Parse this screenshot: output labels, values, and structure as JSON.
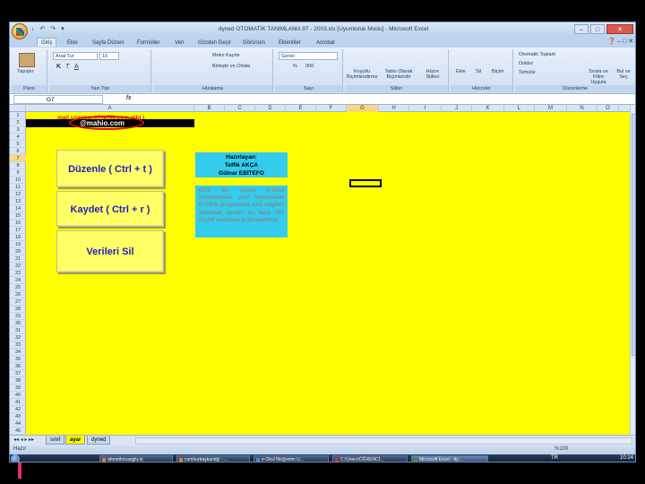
{
  "window": {
    "title": "dyned OTOMATİK TANIMLAMA  97 - 2003.xls  [Uyumluluk Modu]  -  Microsoft Excel",
    "qat": "↓ ↶ ↷ ▾",
    "min": "–",
    "max": "□",
    "close": "✕"
  },
  "ribbon": {
    "tabs": [
      "Giriş",
      "Ekle",
      "Sayfa Düzeni",
      "Formüller",
      "Veri",
      "Gözden Geçir",
      "Görünüm",
      "Eklentiler",
      "Acrobat"
    ],
    "right_icons": "❓ – □ ✕",
    "groups": {
      "clipboard": {
        "label": "Pano",
        "paste": "Yapıştır"
      },
      "font": {
        "label": "Yazı Tipi",
        "font_name": "Arial Tur",
        "font_size": "10",
        "bold": "K",
        "italic": "T",
        "underline": "A"
      },
      "alignment": {
        "label": "Hizalama",
        "wrap": "Metni Kaydır",
        "merge": "Birleştir ve Ortala"
      },
      "number": {
        "label": "Sayı",
        "format": "Genel",
        "percent": "%",
        "comma": "000"
      },
      "styles": {
        "label": "Stiller",
        "conditional": "Koşullu Biçimlendirme",
        "table": "Tablo Olarak Biçimlendir",
        "cell": "Hücre Stilleri"
      },
      "cells": {
        "label": "Hücreler",
        "insert": "Ekle",
        "delete": "Sil",
        "format": "Biçim"
      },
      "editing": {
        "label": "Düzenleme",
        "autosum": "Otomatik Toplam",
        "fill": "Doldur",
        "clear": "Temizle",
        "sort": "Sırala ve Filtre Uygula",
        "find": "Bul ve Seç"
      }
    }
  },
  "formula_bar": {
    "name_box": "G7",
    "fx": "fx"
  },
  "columns": [
    "A",
    "B",
    "C",
    "D",
    "E",
    "F",
    "G",
    "H",
    "I",
    "J",
    "K",
    "L",
    "M",
    "N",
    "O"
  ],
  "sheet": {
    "mail_label": "mail uzantısı (@teffik.com gibi )",
    "email": "@mahio.com",
    "buttons": {
      "edit": "Düzenle  ( Ctrl + t )",
      "save": "Kaydet ( Ctrl + r )",
      "delete": "Verileri Sil"
    },
    "info": {
      "heading": "Hazırlayan:",
      "author1": "Teffik AKÇA",
      "author2": "Gülnar EBİTEFO"
    },
    "note": "NOT: Bu sistem E-Okul Sistemindeki sınıf listesindeki DYNED programına sınıf bilgileri aktarmak içindir. En fazla 100 Kişilik sınıflarda kullanılabilinir."
  },
  "sheet_tabs": {
    "nav": "◂◂ ◂ ▸ ▸▸",
    "tabs": [
      "sınıf",
      "ayar",
      "dyned"
    ]
  },
  "statusbar": {
    "ready": "Hazır",
    "zoom": "%100"
  },
  "taskbar": {
    "items": [
      "ahmethocaoglu.io",
      "cumhurbaşkanlığı - ...",
      "e-Okul İlköğretim U...",
      "C:\\Users\\ÖĞRENCİ...",
      "Microsoft Excel - dy..."
    ],
    "clock": "10:24",
    "tray": "TR"
  },
  "colors": {
    "sheet_bg": "#ffff00",
    "button_text": "#2020c0",
    "info_bg": "#33ccee",
    "mail_label": "#d02020"
  }
}
